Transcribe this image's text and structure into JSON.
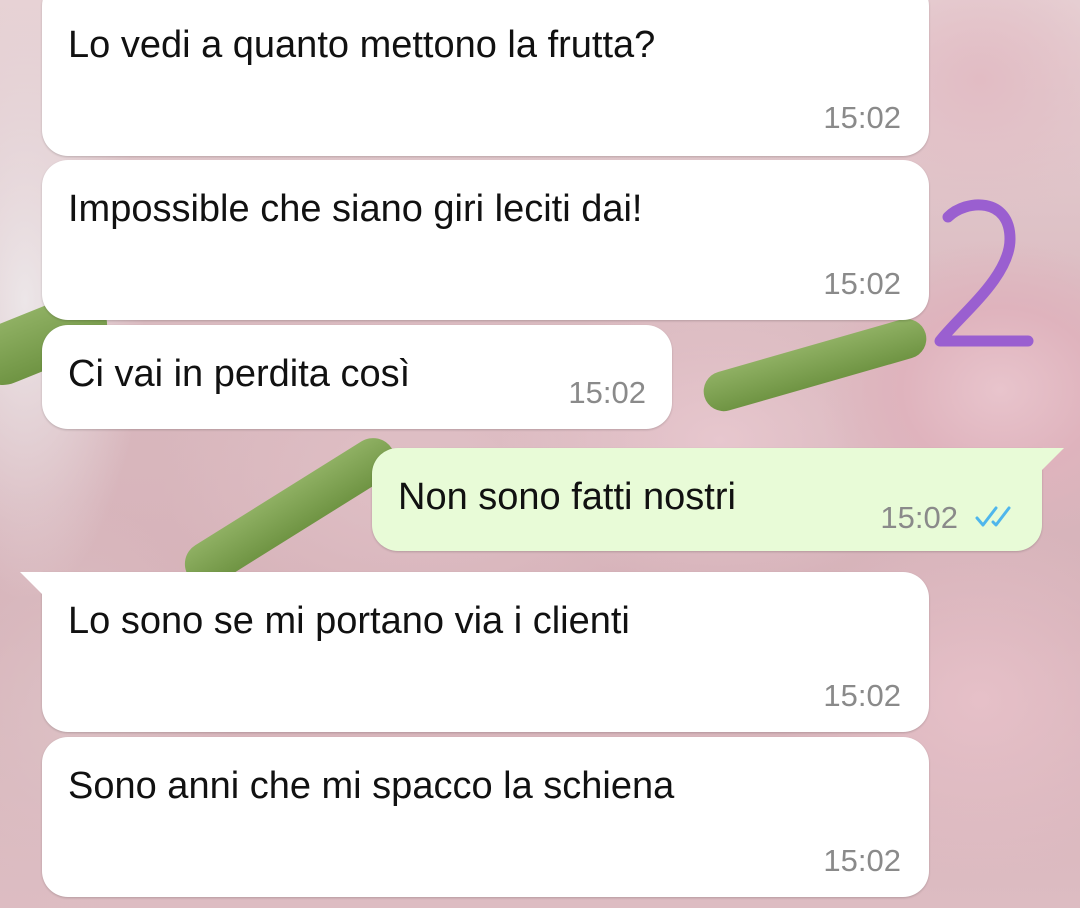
{
  "messages": [
    {
      "direction": "incoming",
      "text": "Lo vedi a quanto mettono la frutta?",
      "time": "15:02"
    },
    {
      "direction": "incoming",
      "text": "Impossible che siano giri leciti dai!",
      "time": "15:02"
    },
    {
      "direction": "incoming",
      "text": "Ci vai in perdita così",
      "time": "15:02"
    },
    {
      "direction": "outgoing",
      "text": "Non sono fatti nostri",
      "time": "15:02",
      "status": "read",
      "status_icon": "double-check-icon"
    },
    {
      "direction": "incoming",
      "text": "Lo sono se mi portano via i clienti",
      "time": "15:02"
    },
    {
      "direction": "incoming",
      "text": "Sono anni che mi spacco la schiena",
      "time": "15:02"
    }
  ],
  "annotation": {
    "glyph": "2",
    "color": "#9a5fd0"
  },
  "colors": {
    "incoming_bubble": "#ffffff",
    "outgoing_bubble": "#e8fbd7",
    "timestamp": "#8a8a8a",
    "read_ticks": "#4fb6ec"
  }
}
